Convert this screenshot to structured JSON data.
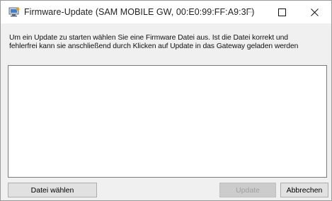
{
  "window": {
    "title": "Firmware-Update (SAM MOBILE GW, 00:E0:99:FF:A9:3F)"
  },
  "instructions": {
    "line1": "Um ein Update zu starten wählen Sie eine Firmware Datei aus. Ist die Datei korrekt und",
    "line2": "fehlerfrei kann sie anschließend durch Klicken auf Update in das Gateway geladen werden"
  },
  "log": {
    "content": ""
  },
  "buttons": {
    "choose_file": "Datei wählen",
    "update": "Update",
    "cancel": "Abbrechen"
  },
  "state": {
    "update_enabled": false
  },
  "icons": {
    "app": "firmware-app-icon",
    "minimize": "minimize-icon",
    "maximize": "maximize-icon",
    "close": "close-icon"
  },
  "colors": {
    "window_bg": "#f0f0f0",
    "titlebar_bg": "#ffffff",
    "button_bg": "#e1e1e1",
    "disabled_text": "#a0a0a0"
  }
}
